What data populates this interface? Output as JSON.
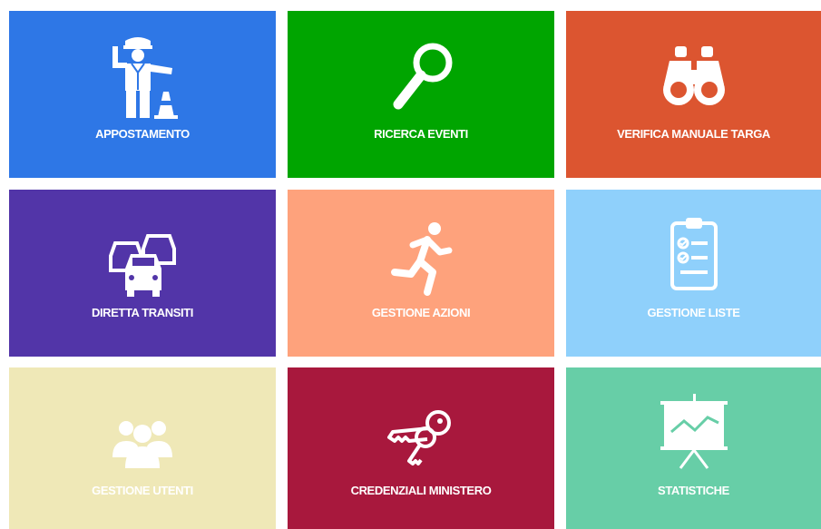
{
  "tiles": [
    {
      "label": "APPOSTAMENTO",
      "icon": "traffic-police-icon",
      "color": "#2e77e6",
      "label_color": "#ffffff"
    },
    {
      "label": "RICERCA EVENTI",
      "icon": "magnifier-icon",
      "color": "#00a500",
      "label_color": "#ffffff"
    },
    {
      "label": "VERIFICA MANUALE TARGA",
      "icon": "binoculars-icon",
      "color": "#dc5530",
      "label_color": "#ffffff"
    },
    {
      "label": "DIRETTA TRANSITI",
      "icon": "cars-traffic-icon",
      "color": "#5235a8",
      "label_color": "#ffffff"
    },
    {
      "label": "GESTIONE AZIONI",
      "icon": "running-man-icon",
      "color": "#fea27c",
      "label_color": "#ffffff"
    },
    {
      "label": "GESTIONE LISTE",
      "icon": "clipboard-checklist-icon",
      "color": "#8fd0fb",
      "label_color": "#ffffff"
    },
    {
      "label": "GESTIONE UTENTI",
      "icon": "users-group-icon",
      "color": "#efe8b7",
      "label_color": "#ffffff"
    },
    {
      "label": "CREDENZIALI MINISTERO",
      "icon": "keys-icon",
      "color": "#a8183d",
      "label_color": "#ffffff"
    },
    {
      "label": "STATISTICHE",
      "icon": "presentation-chart-icon",
      "color": "#67cea7",
      "label_color": "#ffffff"
    }
  ]
}
